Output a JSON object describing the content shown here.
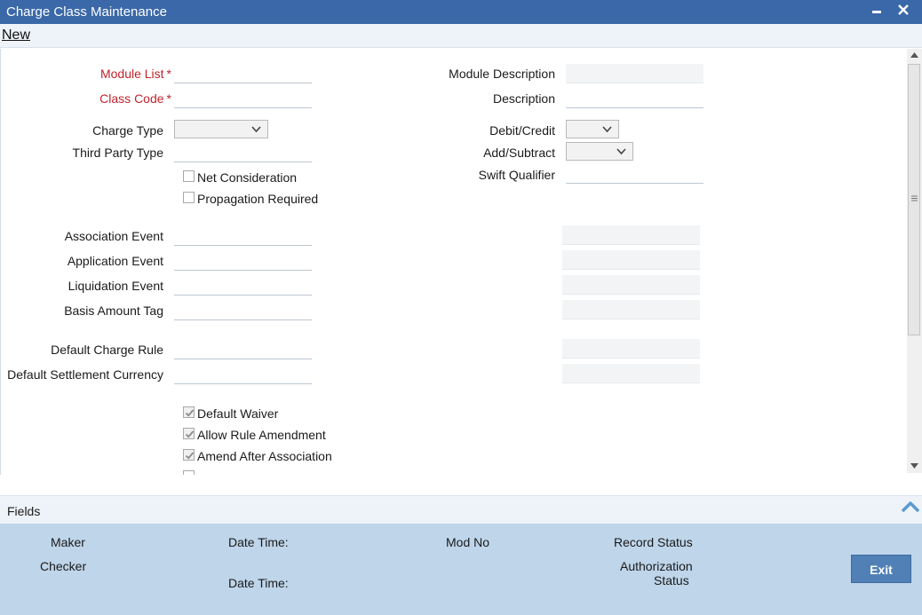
{
  "window": {
    "title": "Charge Class Maintenance",
    "minimize_glyph": "▬",
    "close_glyph": "✕"
  },
  "menu": {
    "new_label": "New"
  },
  "form": {
    "module_list_label": "Module List",
    "class_code_label": "Class Code",
    "required_marker": "*",
    "charge_type_label": "Charge Type",
    "third_party_type_label": "Third Party Type",
    "net_consideration_label": "Net Consideration",
    "propagation_required_label": "Propagation Required",
    "module_description_label": "Module Description",
    "description_label": "Description",
    "debit_credit_label": "Debit/Credit",
    "add_subtract_label": "Add/Subtract",
    "swift_qualifier_label": "Swift Qualifier",
    "association_event_label": "Association Event",
    "application_event_label": "Application Event",
    "liquidation_event_label": "Liquidation Event",
    "basis_amount_tag_label": "Basis Amount Tag",
    "default_charge_rule_label": "Default Charge Rule",
    "default_settlement_currency_label": "Default Settlement Currency",
    "default_waiver_label": "Default Waiver",
    "allow_rule_amendment_label": "Allow Rule Amendment",
    "amend_after_association_label": "Amend After Association",
    "default_waiver_checked": true,
    "allow_rule_amendment_checked": true,
    "amend_after_association_checked": true,
    "net_consideration_checked": false,
    "propagation_required_checked": false
  },
  "footer": {
    "fields_label": "Fields",
    "maker_label": "Maker",
    "checker_label": "Checker",
    "date_time_label_1": "Date Time:",
    "date_time_label_2": "Date Time:",
    "mod_no_label": "Mod No",
    "record_status_label": "Record Status",
    "authorization_label": "Authorization",
    "status_label": "Status",
    "exit_label": "Exit"
  },
  "colors": {
    "titlebar": "#3a68a8",
    "required": "#c0242c",
    "audit_bg": "#bed5ea",
    "exit_button": "#5080b5"
  }
}
